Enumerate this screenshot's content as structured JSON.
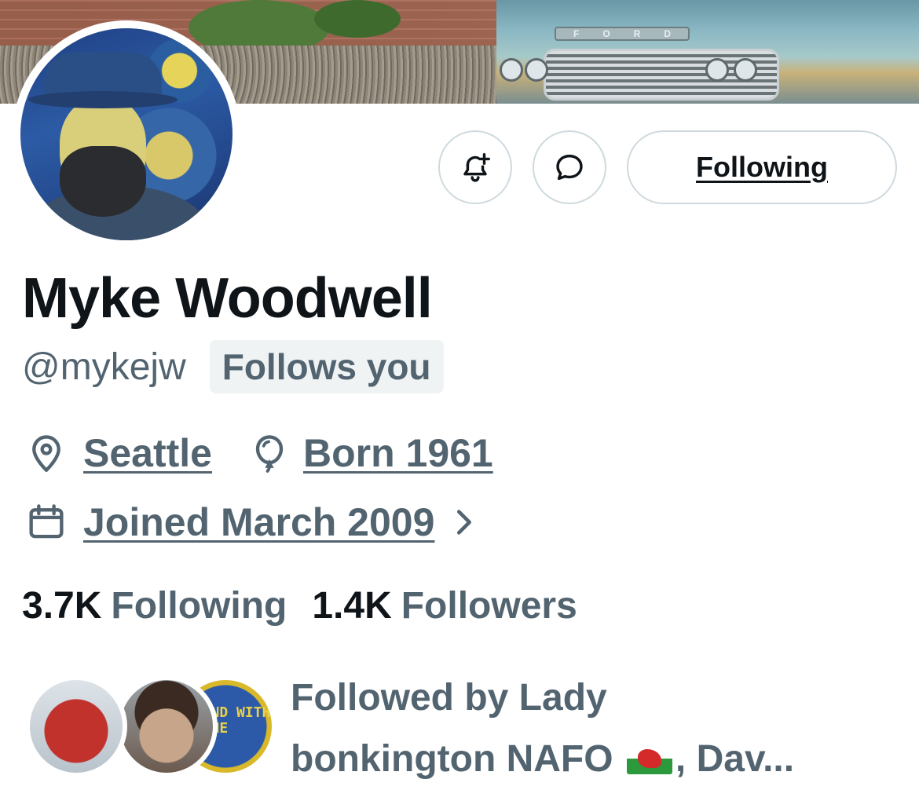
{
  "profile": {
    "name": "Myke Woodwell",
    "handle": "@mykejw",
    "follows_you_badge": "Follows you",
    "location": "Seattle",
    "birth": "Born 1961",
    "joined": "Joined March 2009",
    "following_count": "3.7K",
    "following_label": "Following",
    "followers_count": "1.4K",
    "followers_label": "Followers"
  },
  "actions": {
    "notify_icon": "bell-plus-icon",
    "message_icon": "message-bubble-icon",
    "follow_button_label": "Following"
  },
  "banner": {
    "truck_badge": "FORD"
  },
  "followed_by": {
    "line1": "Followed by Lady",
    "line2_start": "bonkington NAFO",
    "line2_end": ", Dav...",
    "avatar3_text": "STAND WITH RAINE"
  },
  "colors": {
    "text_primary": "#0f1419",
    "text_secondary": "#536471",
    "border": "#cfd9de",
    "badge_bg": "#eff3f4"
  }
}
